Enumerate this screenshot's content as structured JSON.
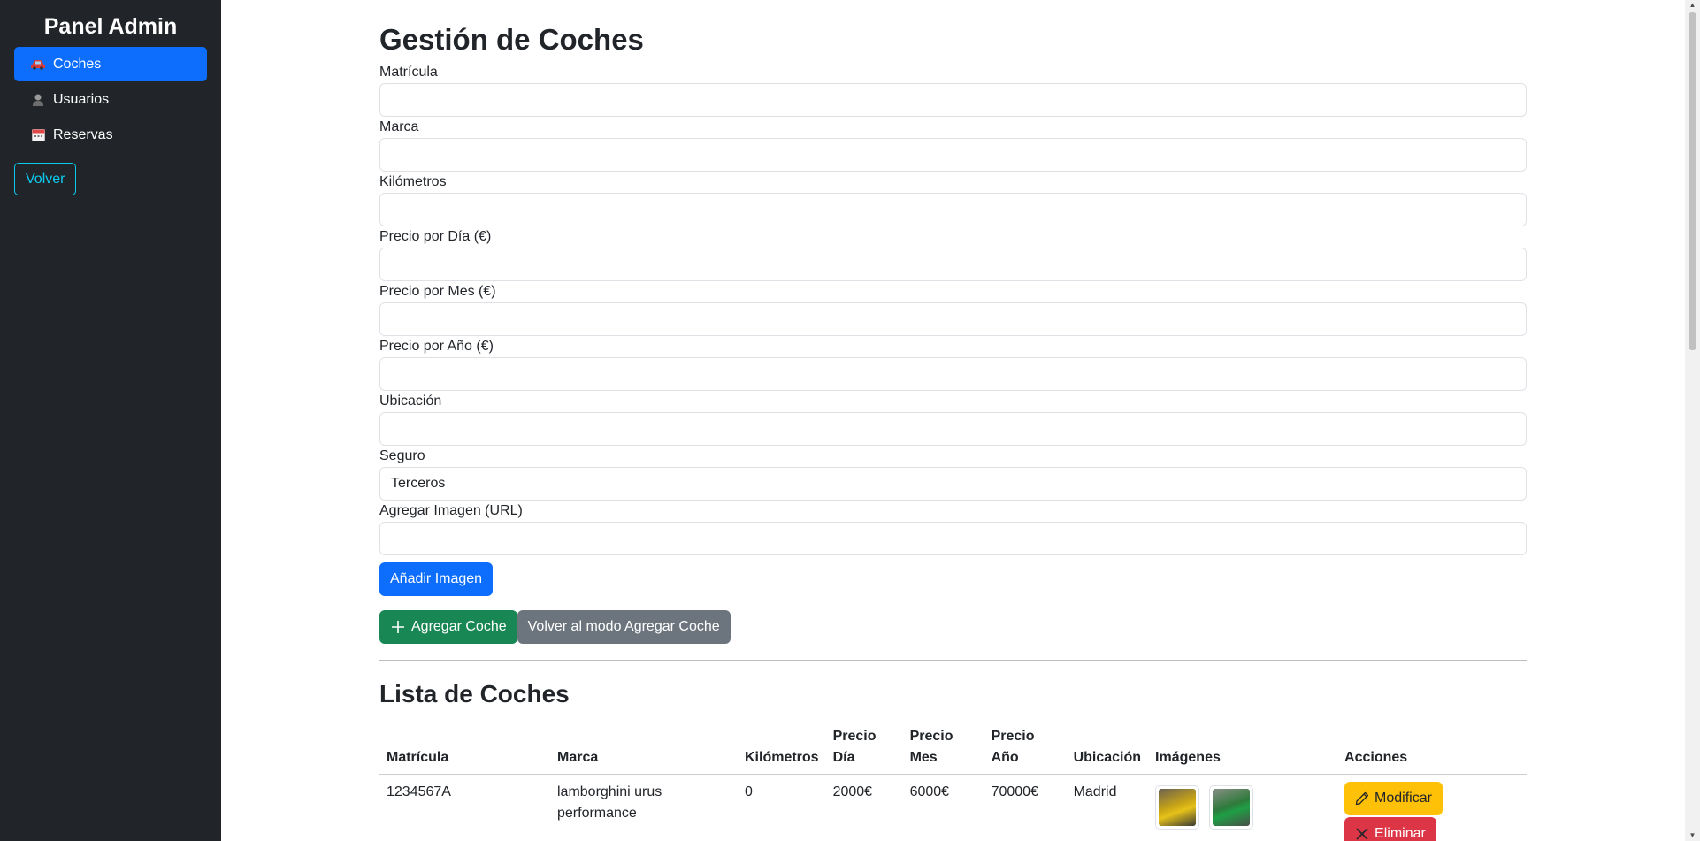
{
  "sidebar": {
    "title": "Panel Admin",
    "items": [
      {
        "label": "Coches",
        "icon": "car-icon"
      },
      {
        "label": "Usuarios",
        "icon": "user-icon"
      },
      {
        "label": "Reservas",
        "icon": "calendar-icon"
      }
    ],
    "back_label": "Volver"
  },
  "main": {
    "title": "Gestión de Coches",
    "fields": [
      {
        "label": "Matrícula",
        "value": ""
      },
      {
        "label": "Marca",
        "value": ""
      },
      {
        "label": "Kilómetros",
        "value": ""
      },
      {
        "label": "Precio por Día (€)",
        "value": ""
      },
      {
        "label": "Precio por Mes (€)",
        "value": ""
      },
      {
        "label": "Precio por Año (€)",
        "value": ""
      },
      {
        "label": "Ubicación",
        "value": ""
      },
      {
        "label": "Seguro",
        "value": "Terceros"
      },
      {
        "label": "Agregar Imagen (URL)",
        "value": ""
      }
    ],
    "add_image_label": "Añadir Imagen",
    "add_car_label": "Agregar Coche",
    "reset_mode_label": "Volver al modo Agregar Coche",
    "list_title": "Lista de Coches",
    "table": {
      "headers": [
        "Matrícula",
        "Marca",
        "Kilómetros",
        "Precio Día",
        "Precio Mes",
        "Precio Año",
        "Ubicación",
        "Imágenes",
        "Acciones"
      ],
      "rows": [
        {
          "matricula": "1234567A",
          "marca": "lamborghini urus performance",
          "kilometros": "0",
          "precio_dia": "2000€",
          "precio_mes": "6000€",
          "precio_ano": "70000€",
          "ubicacion": "Madrid"
        }
      ]
    },
    "modify_label": "Modificar",
    "delete_label": "Eliminar"
  },
  "colors": {
    "sidebar_bg": "#212529",
    "primary": "#0d6efd",
    "success": "#198754",
    "secondary": "#6c757d",
    "warning": "#ffc107",
    "danger": "#dc3545",
    "info": "#0dcaf0"
  }
}
